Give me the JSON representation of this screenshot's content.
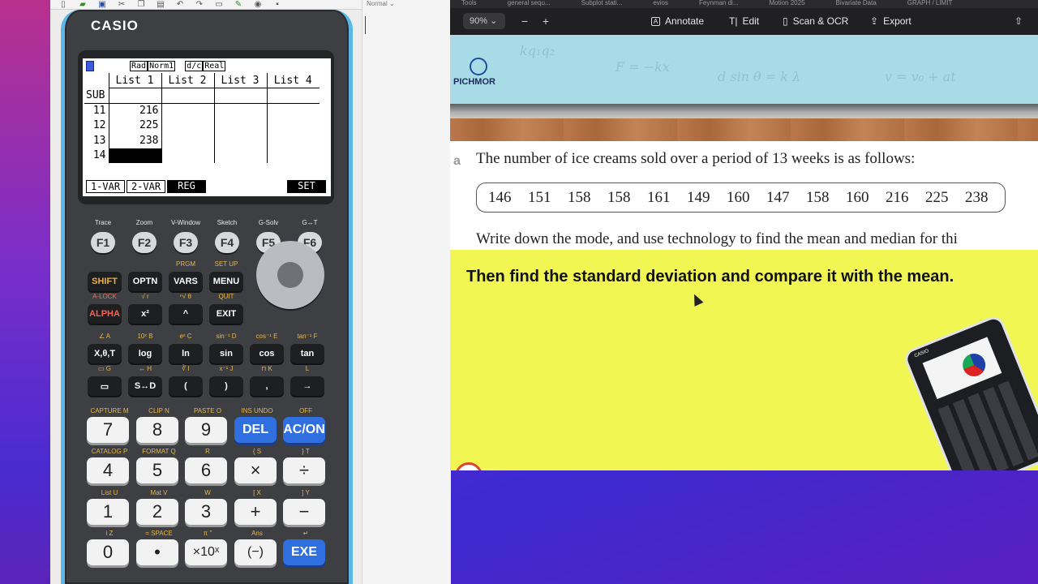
{
  "emulator": {
    "toolbar_icons": [
      "new-file-icon",
      "open-folder-icon",
      "save-icon",
      "cut-icon",
      "copy-icon",
      "paste-icon",
      "undo-icon",
      "redo-icon",
      "screen-capture-icon",
      "settings-icon",
      "camera-icon",
      "window-icon"
    ],
    "side_label": "Normal",
    "brand": "CASIO",
    "screen": {
      "status_tags": [
        "Rad",
        "Norm1",
        "d/c",
        "Real"
      ],
      "columns": [
        "List 1",
        "List 2",
        "List 3",
        "List 4"
      ],
      "sub_label": "SUB",
      "rows": [
        {
          "index": "11",
          "list1": "216"
        },
        {
          "index": "12",
          "list1": "225"
        },
        {
          "index": "13",
          "list1": "238"
        },
        {
          "index": "14",
          "list1": ""
        }
      ],
      "softkeys": [
        "1-VAR",
        "2-VAR",
        "REG",
        "SET"
      ]
    },
    "fkeys": [
      {
        "top": "Trace",
        "label": "F1"
      },
      {
        "top": "Zoom",
        "label": "F2"
      },
      {
        "top": "V-Window",
        "label": "F3"
      },
      {
        "top": "Sketch",
        "label": "F4"
      },
      {
        "top": "G-Solv",
        "label": "F5"
      },
      {
        "top": "G↔T",
        "label": "F6"
      }
    ],
    "row1": [
      {
        "top": "",
        "label": "SHIFT"
      },
      {
        "top": "",
        "label": "OPTN"
      },
      {
        "top": "PRGM",
        "label": "VARS"
      },
      {
        "top": "SET UP",
        "label": "MENU"
      }
    ],
    "row2": [
      {
        "top": "A-LOCK",
        "label": "ALPHA"
      },
      {
        "top": "√      r",
        "label": "x²"
      },
      {
        "top": "ⁿ√     θ",
        "label": "^"
      },
      {
        "top": "QUIT",
        "label": "EXIT"
      }
    ],
    "row3": [
      {
        "top": "∠        A",
        "label": "X,θ,T"
      },
      {
        "top": "10ˣ      B",
        "label": "log"
      },
      {
        "top": "eˣ       C",
        "label": "ln"
      },
      {
        "top": "sin⁻¹    D",
        "label": "sin"
      },
      {
        "top": "cos⁻¹    E",
        "label": "cos"
      },
      {
        "top": "tan⁻¹    F",
        "label": "tan"
      }
    ],
    "row4": [
      {
        "top": "▭        G",
        "label": "▭"
      },
      {
        "top": "↔        H",
        "label": "S↔D"
      },
      {
        "top": "∛        I",
        "label": "("
      },
      {
        "top": "x⁻¹      J",
        "label": ")"
      },
      {
        "top": "⊓        K",
        "label": ","
      },
      {
        "top": "         L",
        "label": "→"
      }
    ],
    "num_rows": [
      [
        {
          "top": "CAPTURE  M",
          "label": "7"
        },
        {
          "top": "CLIP     N",
          "label": "8"
        },
        {
          "top": "PASTE    O",
          "label": "9"
        },
        {
          "top": "INS  UNDO",
          "label": "DEL"
        },
        {
          "top": "OFF",
          "label": "AC/ON"
        }
      ],
      [
        {
          "top": "CATALOG  P",
          "label": "4"
        },
        {
          "top": "FORMAT   Q",
          "label": "5"
        },
        {
          "top": "         R",
          "label": "6"
        },
        {
          "top": "{        S",
          "label": "×"
        },
        {
          "top": "}        T",
          "label": "÷"
        }
      ],
      [
        {
          "top": "List     U",
          "label": "1"
        },
        {
          "top": "Mat      V",
          "label": "2"
        },
        {
          "top": "         W",
          "label": "3"
        },
        {
          "top": "[        X",
          "label": "+"
        },
        {
          "top": "]        Y",
          "label": "−"
        }
      ],
      [
        {
          "top": "i        Z",
          "label": "0"
        },
        {
          "top": "=   SPACE",
          "label": "•"
        },
        {
          "top": "π       \"",
          "label": "×10ˣ"
        },
        {
          "top": "Ans",
          "label": "(−)"
        },
        {
          "top": "↵",
          "label": "EXE"
        }
      ]
    ]
  },
  "pdf": {
    "tabs": [
      "Tools",
      "general sequ...",
      "Subplot stati...",
      "evios",
      "Feynman di...",
      "Motion 2025",
      "Bivariate Data",
      "GRAPH / LIMIT"
    ],
    "zoom": "90%",
    "toolbar": [
      {
        "label": "Annotate",
        "icon": "annotate-icon"
      },
      {
        "label": "Edit",
        "icon": "text-edit-icon"
      },
      {
        "label": "Scan & OCR",
        "icon": "scan-icon"
      },
      {
        "label": "Export",
        "icon": "export-icon"
      }
    ],
    "logo_text": "PICHMOR",
    "banner_formulas": [
      "kq₁q₂",
      "F = −kx",
      "d sin θ = k λ",
      "v = v₀ + at"
    ],
    "question_letter": "a",
    "question_text": "The number of ice creams sold over a period of 13 weeks is as follows:",
    "data_values": [
      "146",
      "151",
      "158",
      "158",
      "161",
      "149",
      "160",
      "147",
      "158",
      "160",
      "216",
      "225",
      "238"
    ],
    "question_text2": "Write down the mode, and use technology to find the mean and median for thi",
    "task_text": "Then find the standard deviation and compare it with the mean.",
    "mini_calc_brand": "CASIO"
  },
  "colors": {
    "calc_trim": "#5bb7e8",
    "highlight": "#f2f652",
    "banner": "#a9dbe6",
    "exe_blue": "#2f6fe0"
  }
}
